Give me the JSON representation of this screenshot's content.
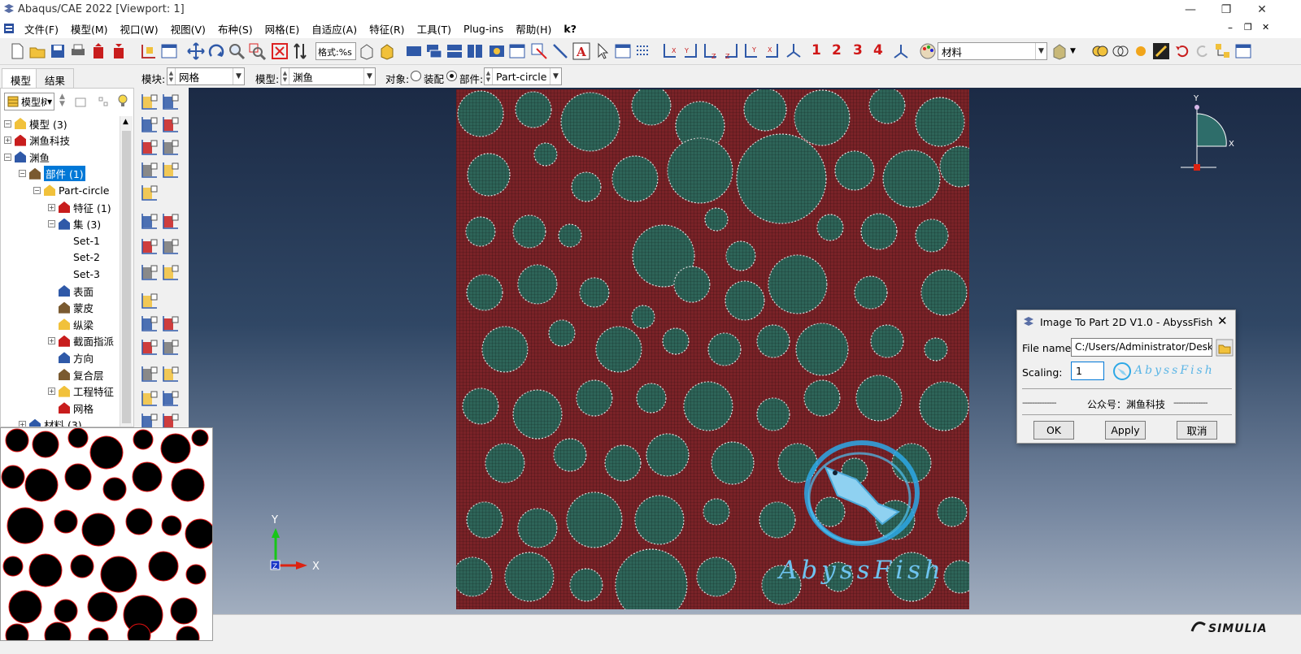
{
  "window": {
    "title": "Abaqus/CAE 2022 [Viewport: 1]",
    "minimize": "—",
    "restore": "❐",
    "close": "✕",
    "mdi_min": "–",
    "mdi_restore": "❐",
    "mdi_close": "✕"
  },
  "menu": [
    "文件(F)",
    "模型(M)",
    "视口(W)",
    "视图(V)",
    "布种(S)",
    "网格(E)",
    "自适应(A)",
    "特征(R)",
    "工具(T)",
    "Plug-ins",
    "帮助(H)",
    "k?"
  ],
  "toolbar": {
    "numbers": [
      "1",
      "2",
      "3",
      "4"
    ],
    "style_label": "格式:%s",
    "material_combo": "材料"
  },
  "context": {
    "module_label": "模块:",
    "module_value": "网格",
    "model_label": "模型:",
    "model_value": "渊鱼",
    "object_label": "对象:",
    "assembly_option": "装配",
    "part_option": "部件:",
    "part_value": "Part-circle"
  },
  "tabs": [
    "模型",
    "结果"
  ],
  "tree_combo": "模型树",
  "tree": [
    {
      "label": "模型 (3)",
      "level": 0,
      "exp": "minus"
    },
    {
      "label": "渊鱼科技",
      "level": 0,
      "exp": "plus"
    },
    {
      "label": "渊鱼",
      "level": 0,
      "exp": "minus"
    },
    {
      "label": "部件 (1)",
      "level": 1,
      "exp": "minus",
      "selected": true
    },
    {
      "label": "Part-circle",
      "level": 2,
      "exp": "minus"
    },
    {
      "label": "特征 (1)",
      "level": 3,
      "exp": "plus"
    },
    {
      "label": "集 (3)",
      "level": 3,
      "exp": "minus"
    },
    {
      "label": "Set-1",
      "level": 4
    },
    {
      "label": "Set-2",
      "level": 4
    },
    {
      "label": "Set-3",
      "level": 4
    },
    {
      "label": "表面",
      "level": 3
    },
    {
      "label": "蒙皮",
      "level": 3
    },
    {
      "label": "纵梁",
      "level": 3
    },
    {
      "label": "截面指派",
      "level": 3,
      "exp": "plus"
    },
    {
      "label": "方向",
      "level": 3
    },
    {
      "label": "复合层",
      "level": 3
    },
    {
      "label": "工程特征",
      "level": 3,
      "exp": "plus"
    },
    {
      "label": "网格",
      "level": 3
    },
    {
      "label": "材料 (3)",
      "level": 1,
      "exp": "plus"
    }
  ],
  "viewport": {
    "triad_x": "X",
    "triad_y": "Y",
    "triad_z": "Z",
    "mini_x": "X",
    "mini_y": "Y",
    "watermark": "AbyssFish"
  },
  "dialog": {
    "title": "Image To Part 2D V1.0 - AbyssFish",
    "file_label": "File name:",
    "file_value": "C:/Users/Administrator/Deskt",
    "scaling_label": "Scaling:",
    "scaling_value": "1",
    "logo_text": "AbyssFish",
    "divider_text": "公众号：渊鱼科技",
    "dashes": "--------------",
    "ok": "OK",
    "apply": "Apply",
    "cancel": "取消"
  },
  "status": {
    "brand": "SIMULIA"
  },
  "colors": {
    "mesh_bg": "#7a2328",
    "particle": "#2e6458",
    "accent_blue": "#0078d7"
  }
}
